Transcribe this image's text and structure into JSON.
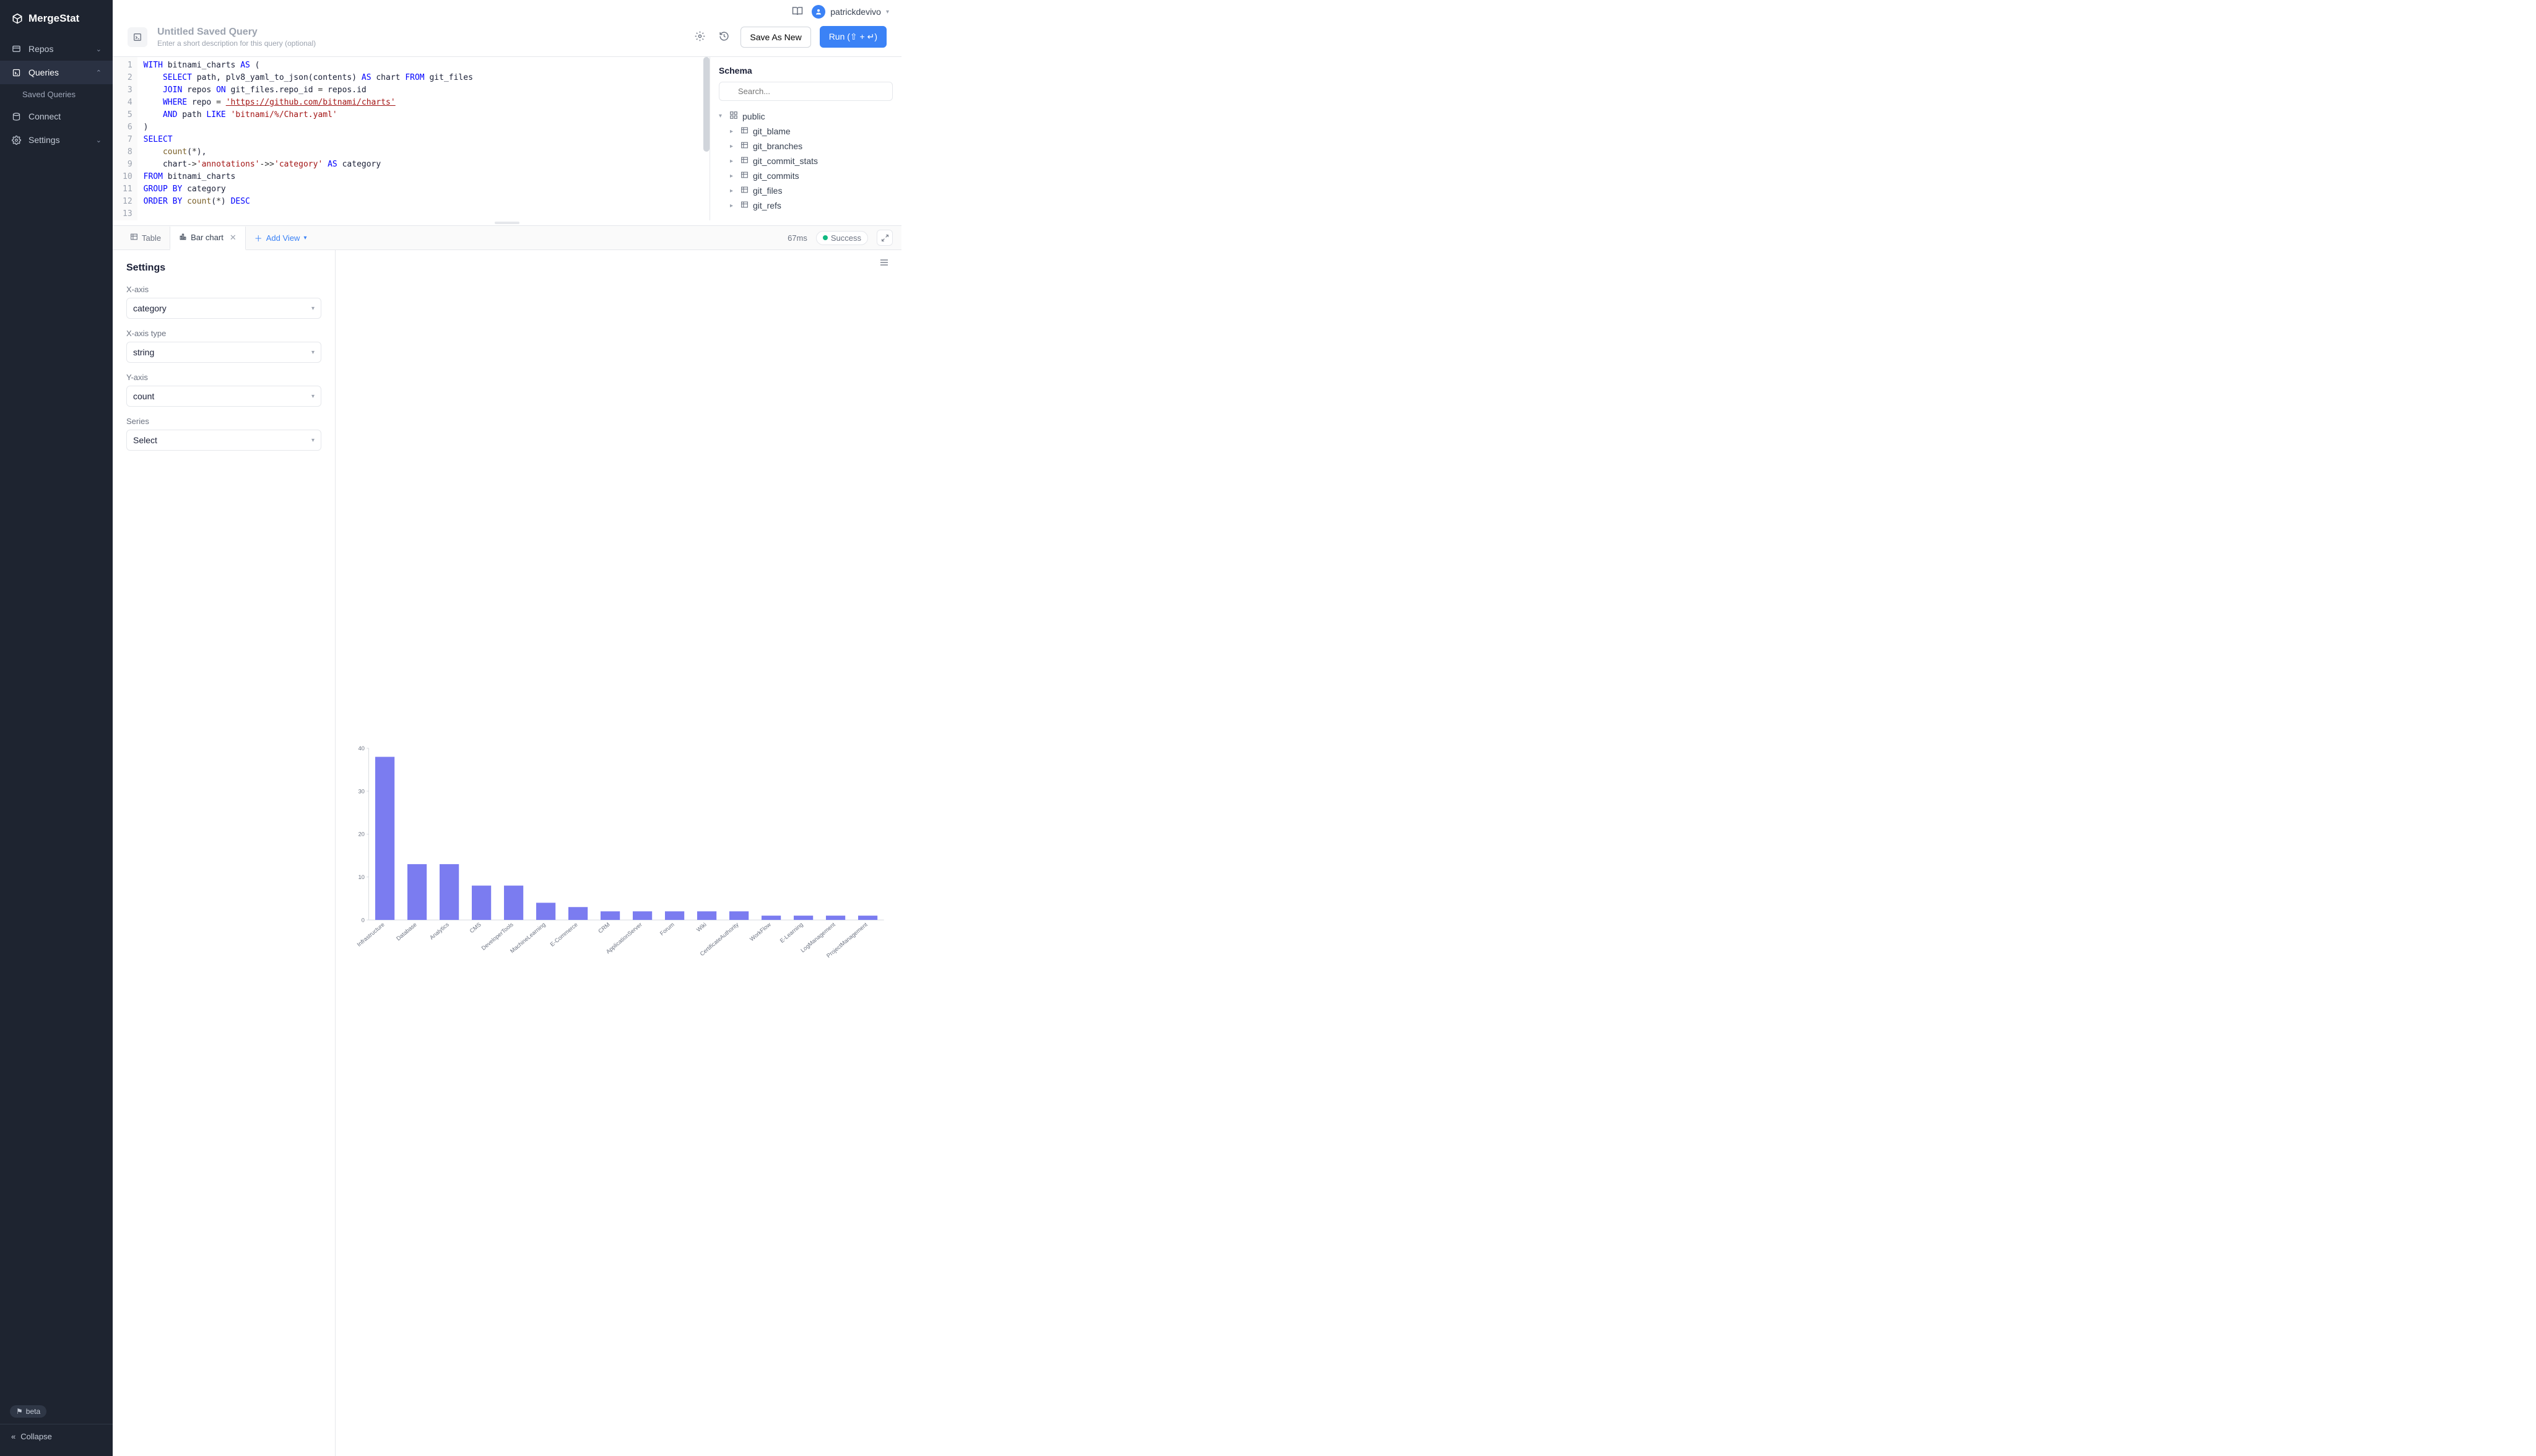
{
  "brand": "MergeStat",
  "sidebar": {
    "items": [
      {
        "label": "Repos",
        "icon": "repo",
        "expandable": true
      },
      {
        "label": "Queries",
        "icon": "query",
        "expandable": true,
        "active": true
      },
      {
        "label": "Connect",
        "icon": "connect"
      },
      {
        "label": "Settings",
        "icon": "settings",
        "expandable": true
      }
    ],
    "sub_saved": "Saved Queries",
    "beta": "beta",
    "collapse": "Collapse"
  },
  "user": {
    "name": "patrickdevivo"
  },
  "query": {
    "title": "Untitled Saved Query",
    "desc": "Enter a short description for this query (optional)",
    "save_as_new": "Save As New",
    "run": "Run (⇧ + ↵)"
  },
  "code_lines": [
    [
      [
        "kw",
        "WITH"
      ],
      [
        "",
        " bitnami_charts "
      ],
      [
        "kw",
        "AS"
      ],
      [
        "",
        " ("
      ]
    ],
    [
      [
        "",
        "    "
      ],
      [
        "kw",
        "SELECT"
      ],
      [
        "",
        " path, plv8_yaml_to_json(contents) "
      ],
      [
        "kw",
        "AS"
      ],
      [
        "",
        " chart "
      ],
      [
        "kw",
        "FROM"
      ],
      [
        "",
        " git_files"
      ]
    ],
    [
      [
        "",
        "    "
      ],
      [
        "kw",
        "JOIN"
      ],
      [
        "",
        " repos "
      ],
      [
        "kw",
        "ON"
      ],
      [
        "",
        " git_files.repo_id "
      ],
      [
        "op",
        "="
      ],
      [
        "",
        " repos.id"
      ]
    ],
    [
      [
        "",
        "    "
      ],
      [
        "kw",
        "WHERE"
      ],
      [
        "",
        " repo "
      ],
      [
        "op",
        "="
      ],
      [
        "",
        " "
      ],
      [
        "url",
        "'https://github.com/bitnami/charts'"
      ]
    ],
    [
      [
        "",
        "    "
      ],
      [
        "kw",
        "AND"
      ],
      [
        "",
        " path "
      ],
      [
        "kw",
        "LIKE"
      ],
      [
        "",
        " "
      ],
      [
        "str",
        "'bitnami/%/Chart.yaml'"
      ]
    ],
    [
      [
        "",
        ")"
      ]
    ],
    [
      [
        "kw",
        "SELECT"
      ]
    ],
    [
      [
        "",
        "    "
      ],
      [
        "fn",
        "count"
      ],
      [
        "",
        "("
      ],
      [
        "op",
        "*"
      ],
      [
        "",
        "),"
      ]
    ],
    [
      [
        "",
        "    chart"
      ],
      [
        "op",
        "->"
      ],
      [
        "str",
        "'annotations'"
      ],
      [
        "op",
        "->>"
      ],
      [
        "str",
        "'category'"
      ],
      [
        "",
        " "
      ],
      [
        "kw",
        "AS"
      ],
      [
        "",
        " category"
      ]
    ],
    [
      [
        "kw",
        "FROM"
      ],
      [
        "",
        " bitnami_charts"
      ]
    ],
    [
      [
        "kw",
        "GROUP"
      ],
      [
        "",
        " "
      ],
      [
        "kw",
        "BY"
      ],
      [
        "",
        " category"
      ]
    ],
    [
      [
        "kw",
        "ORDER"
      ],
      [
        "",
        " "
      ],
      [
        "kw",
        "BY"
      ],
      [
        "",
        " "
      ],
      [
        "fn",
        "count"
      ],
      [
        "",
        "("
      ],
      [
        "op",
        "*"
      ],
      [
        "",
        ") "
      ],
      [
        "kw",
        "DESC"
      ]
    ],
    [
      [
        "",
        ""
      ]
    ]
  ],
  "schema": {
    "title": "Schema",
    "search_ph": "Search...",
    "root": "public",
    "tables": [
      "git_blame",
      "git_branches",
      "git_commit_stats",
      "git_commits",
      "git_files",
      "git_refs"
    ]
  },
  "tabs": {
    "table": "Table",
    "barchart": "Bar chart",
    "add_view": "Add View"
  },
  "status": {
    "time": "67ms",
    "label": "Success"
  },
  "settings": {
    "heading": "Settings",
    "xaxis_label": "X-axis",
    "xaxis_value": "category",
    "xaxistype_label": "X-axis type",
    "xaxistype_value": "string",
    "yaxis_label": "Y-axis",
    "yaxis_value": "count",
    "series_label": "Series",
    "series_value": "Select"
  },
  "chart_data": {
    "type": "bar",
    "categories": [
      "Infrastructure",
      "Database",
      "Analytics",
      "CMS",
      "DeveloperTools",
      "MachineLearning",
      "E-Commerce",
      "CRM",
      "ApplicationServer",
      "Forum",
      "Wiki",
      "CertificateAuthority",
      "WorkFlow",
      "E-Learning",
      "LogManagement",
      "ProjectManagement"
    ],
    "values": [
      38,
      13,
      13,
      8,
      8,
      4,
      3,
      2,
      2,
      2,
      2,
      2,
      1,
      1,
      1,
      1
    ],
    "ylabel": "",
    "xlabel": "",
    "ylim": [
      0,
      40
    ],
    "yticks": [
      0,
      10,
      20,
      30,
      40
    ]
  }
}
